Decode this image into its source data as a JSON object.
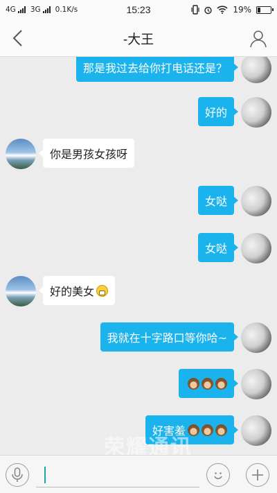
{
  "status_bar": {
    "network1": "4G",
    "network2": "3G",
    "speed": "0.1K/s",
    "time": "15:23",
    "battery": "19%",
    "battery_level": 0.19
  },
  "header": {
    "title": "-大王",
    "back_icon": "back-arrow-icon",
    "profile_icon": "person-icon"
  },
  "messages": [
    {
      "side": "right",
      "text": "那是我过去给你打电话还是？"
    },
    {
      "side": "right",
      "text": "好的"
    },
    {
      "side": "left",
      "text": "你是男孩女孩呀"
    },
    {
      "side": "right",
      "text": "女哒"
    },
    {
      "side": "right",
      "text": "女哒"
    },
    {
      "side": "left",
      "text": "好的美女",
      "emoji": "grinning-face"
    },
    {
      "side": "right",
      "text": "我就在十字路口等你哈~"
    },
    {
      "side": "right",
      "text": "",
      "emoji": "see-no-evil-monkey x3"
    },
    {
      "side": "right",
      "text": "好害羞",
      "emoji": "see-no-evil-monkey x3"
    }
  ],
  "watermark": "荣耀通讯",
  "input_bar": {
    "voice_icon": "microphone-icon",
    "emoji_icon": "smiley-icon",
    "plus_icon": "plus-icon",
    "value": ""
  },
  "colors": {
    "bubble_blue": "#1ab3ed",
    "bubble_white": "#ffffff",
    "background": "#ececec"
  }
}
